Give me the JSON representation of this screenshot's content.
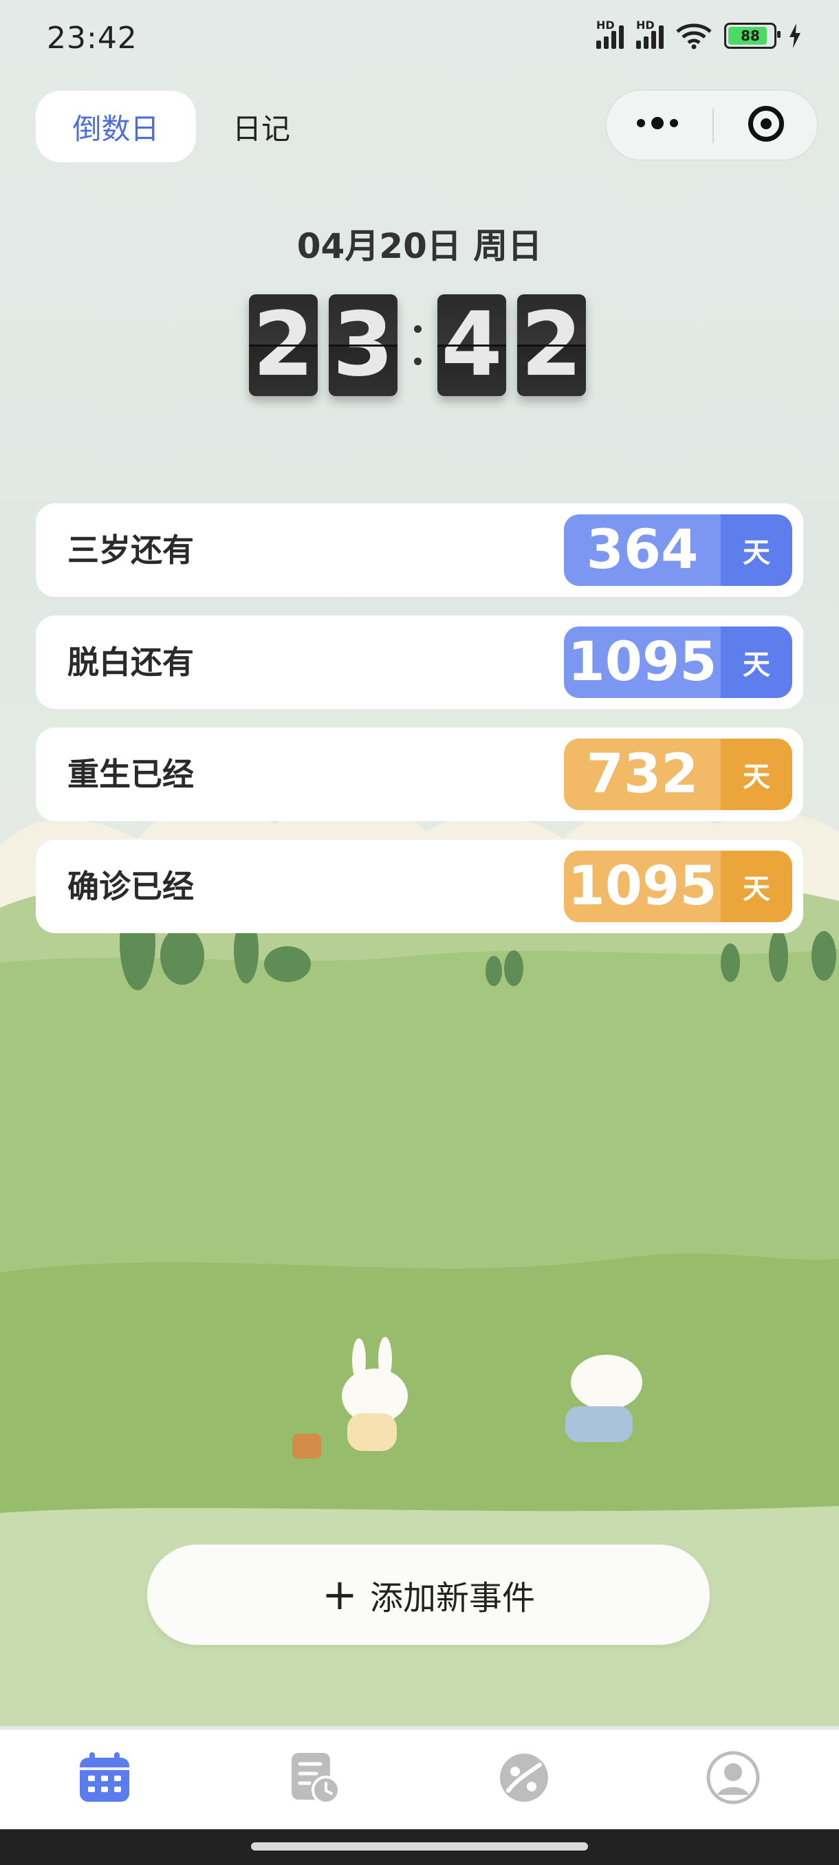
{
  "status_bar": {
    "time": "23:42",
    "signal_1_label": "HD",
    "signal_2_label": "HD",
    "battery_level": "88",
    "icons": [
      "signal-icon",
      "signal-icon",
      "wifi-icon",
      "battery-icon",
      "charging-icon"
    ]
  },
  "header": {
    "tabs": [
      {
        "label": "倒数日",
        "active": true
      },
      {
        "label": "日记",
        "active": false
      }
    ],
    "capsule_icons": [
      "more-icon",
      "close-target-icon"
    ]
  },
  "clock": {
    "date": "04月20日 周日",
    "digits": [
      "2",
      "3",
      "4",
      "2"
    ]
  },
  "events": [
    {
      "name": "三岁还有",
      "days": "364",
      "unit": "天",
      "color": "#7b97f2"
    },
    {
      "name": "脱白还有",
      "days": "1095",
      "unit": "天",
      "color": "#7b97f2"
    },
    {
      "name": "重生已经",
      "days": "732",
      "unit": "天",
      "color": "#f2b967"
    },
    {
      "name": "确诊已经",
      "days": "1095",
      "unit": "天",
      "color": "#f2b967"
    }
  ],
  "add_button": {
    "plus": "+",
    "label": "添加新事件"
  },
  "tabbar": {
    "items": [
      {
        "icon": "calendar-icon",
        "active": true
      },
      {
        "icon": "diary-clock-icon",
        "active": false
      },
      {
        "icon": "explore-icon",
        "active": false
      },
      {
        "icon": "profile-icon",
        "active": false
      }
    ]
  },
  "colors": {
    "accent_blue": "#4a6fdc",
    "pill_blue": "#5f7eee",
    "pill_orange": "#eca53b",
    "inactive_icon": "#bdbdbd"
  }
}
